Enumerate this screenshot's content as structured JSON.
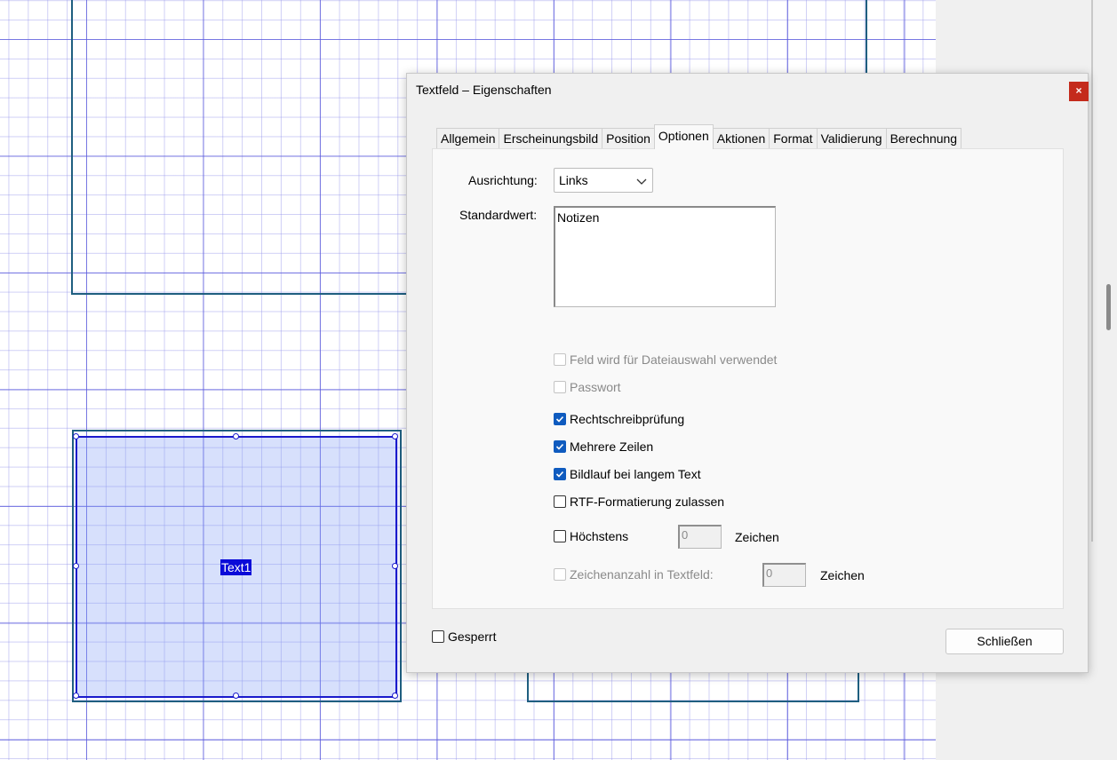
{
  "canvas": {
    "field_name": "Text1"
  },
  "dialog": {
    "title": "Textfeld – Eigenschaften",
    "close_glyph": "×",
    "tabs": [
      {
        "label": "Allgemein",
        "active": false
      },
      {
        "label": "Erscheinungsbild",
        "active": false
      },
      {
        "label": "Position",
        "active": false
      },
      {
        "label": "Optionen",
        "active": true
      },
      {
        "label": "Aktionen",
        "active": false
      },
      {
        "label": "Format",
        "active": false
      },
      {
        "label": "Validierung",
        "active": false
      },
      {
        "label": "Berechnung",
        "active": false
      }
    ],
    "options": {
      "alignment_label": "Ausrichtung:",
      "alignment_value": "Links",
      "default_label": "Standardwert:",
      "default_value": "Notizen",
      "checkboxes": {
        "file_select": {
          "label": "Feld wird für Dateiauswahl verwendet",
          "checked": false,
          "enabled": false
        },
        "password": {
          "label": "Passwort",
          "checked": false,
          "enabled": false
        },
        "spell_check": {
          "label": "Rechtschreibprüfung",
          "checked": true,
          "enabled": true
        },
        "multiline": {
          "label": "Mehrere Zeilen",
          "checked": true,
          "enabled": true
        },
        "scroll_long_text": {
          "label": "Bildlauf bei langem Text",
          "checked": true,
          "enabled": true
        },
        "rich_text": {
          "label": "RTF-Formatierung zulassen",
          "checked": false,
          "enabled": true
        },
        "max_chars": {
          "label": "Höchstens",
          "checked": false,
          "enabled": true
        },
        "comb": {
          "label": "Zeichenanzahl in Textfeld:",
          "checked": false,
          "enabled": false
        }
      },
      "max_chars_value": "0",
      "comb_value": "0",
      "unit_label": "Zeichen"
    },
    "locked_label": "Gesperrt",
    "locked_checked": false,
    "close_button_label": "Schließen"
  },
  "colors": {
    "accent": "#0f5bbf",
    "field_highlight": "#0a0ad8",
    "close_red": "#c42b1c",
    "grid_line": "#5a5adc"
  },
  "icons": [
    "chevron-down-icon",
    "checkmark-icon",
    "close-icon"
  ]
}
